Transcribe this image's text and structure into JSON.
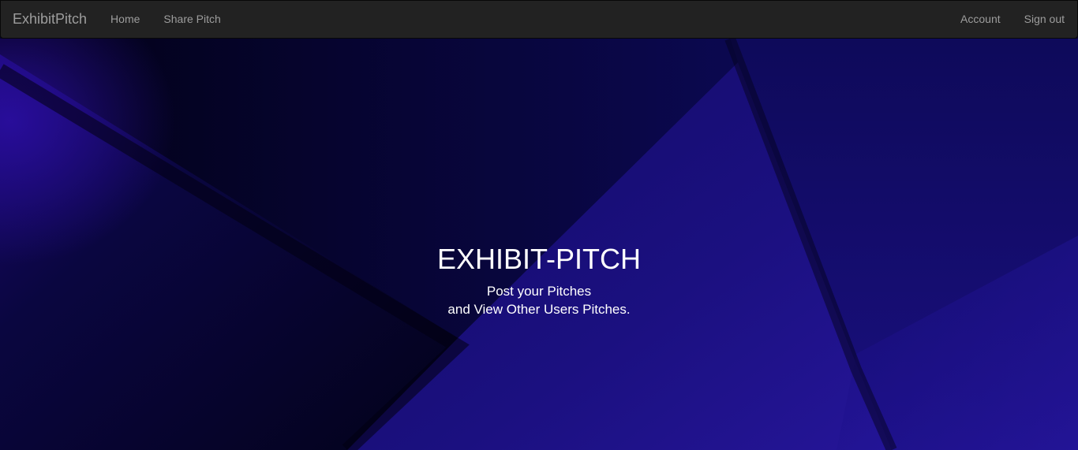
{
  "navbar": {
    "brand": "ExhibitPitch",
    "left_links": [
      "Home",
      "Share Pitch"
    ],
    "right_links": [
      "Account",
      "Sign out"
    ]
  },
  "hero": {
    "title": "EXHIBIT-PITCH",
    "subtitle_line1": "Post your Pitches",
    "subtitle_line2": "and View Other Users Pitches."
  },
  "colors": {
    "navbar_bg": "#222222",
    "nav_text": "#9d9d9d",
    "hero_text": "#ffffff",
    "hero_dark": "#05042a",
    "hero_accent": "#1e0f8a"
  }
}
